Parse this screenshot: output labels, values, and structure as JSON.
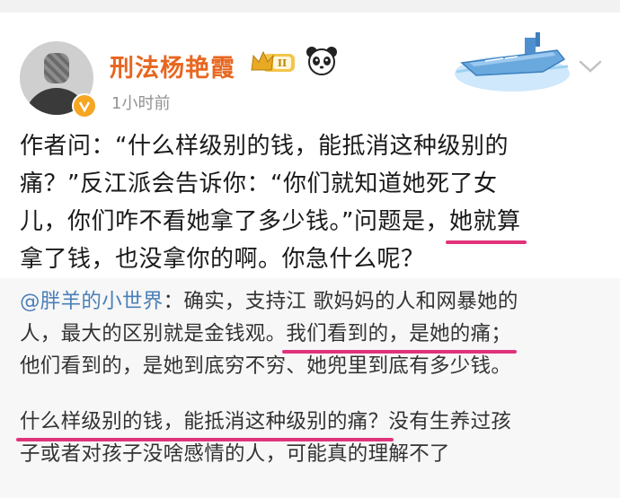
{
  "post": {
    "author": {
      "name": "刑法杨艳霞",
      "vip_level": "II",
      "timestamp": "1小时前"
    },
    "icons": {
      "avatar": "avatar",
      "verified": "verified-badge-icon",
      "vip": "vip-crown-badge-icon",
      "panda": "panda-icon",
      "decoration": "ship-card-decoration",
      "menu": "chevron-down-icon"
    },
    "body": {
      "line1": "作者问：“什么样级别的钱，能抵消这种级别的",
      "line2": "痛？”反江派会告诉你：“你们就知道她死了女",
      "line3_plain": "儿，你们咋不看她拿了多少钱。”问题是，",
      "line3_ul": "她就算",
      "line4_ul": "拿了钱，也没拿你的啊。",
      "line4_plain": "你急什么呢？"
    },
    "quote": {
      "mention": "@胖羊的小世界",
      "q1_rest": "：确实，支持江 歌妈妈的人和网暴她的",
      "q2_plain": "人，最大的区别就是金钱观。",
      "q2_ul": "我们看到的，是她的痛；",
      "q3": "他们看到的，是她到底穷不穷、她兜里到底有多少钱。",
      "q4_ul": "什么样级别的钱，能抵消这种级别的痛？",
      "q4_plain": "没有生养过孩",
      "q5": "子或者对孩子没啥感情的人，可能真的理解不了"
    },
    "colors": {
      "username": "#e8661f",
      "underline": "#e0337a",
      "mention": "#4a7fb8",
      "quote_background": "#f7f7f7"
    }
  }
}
